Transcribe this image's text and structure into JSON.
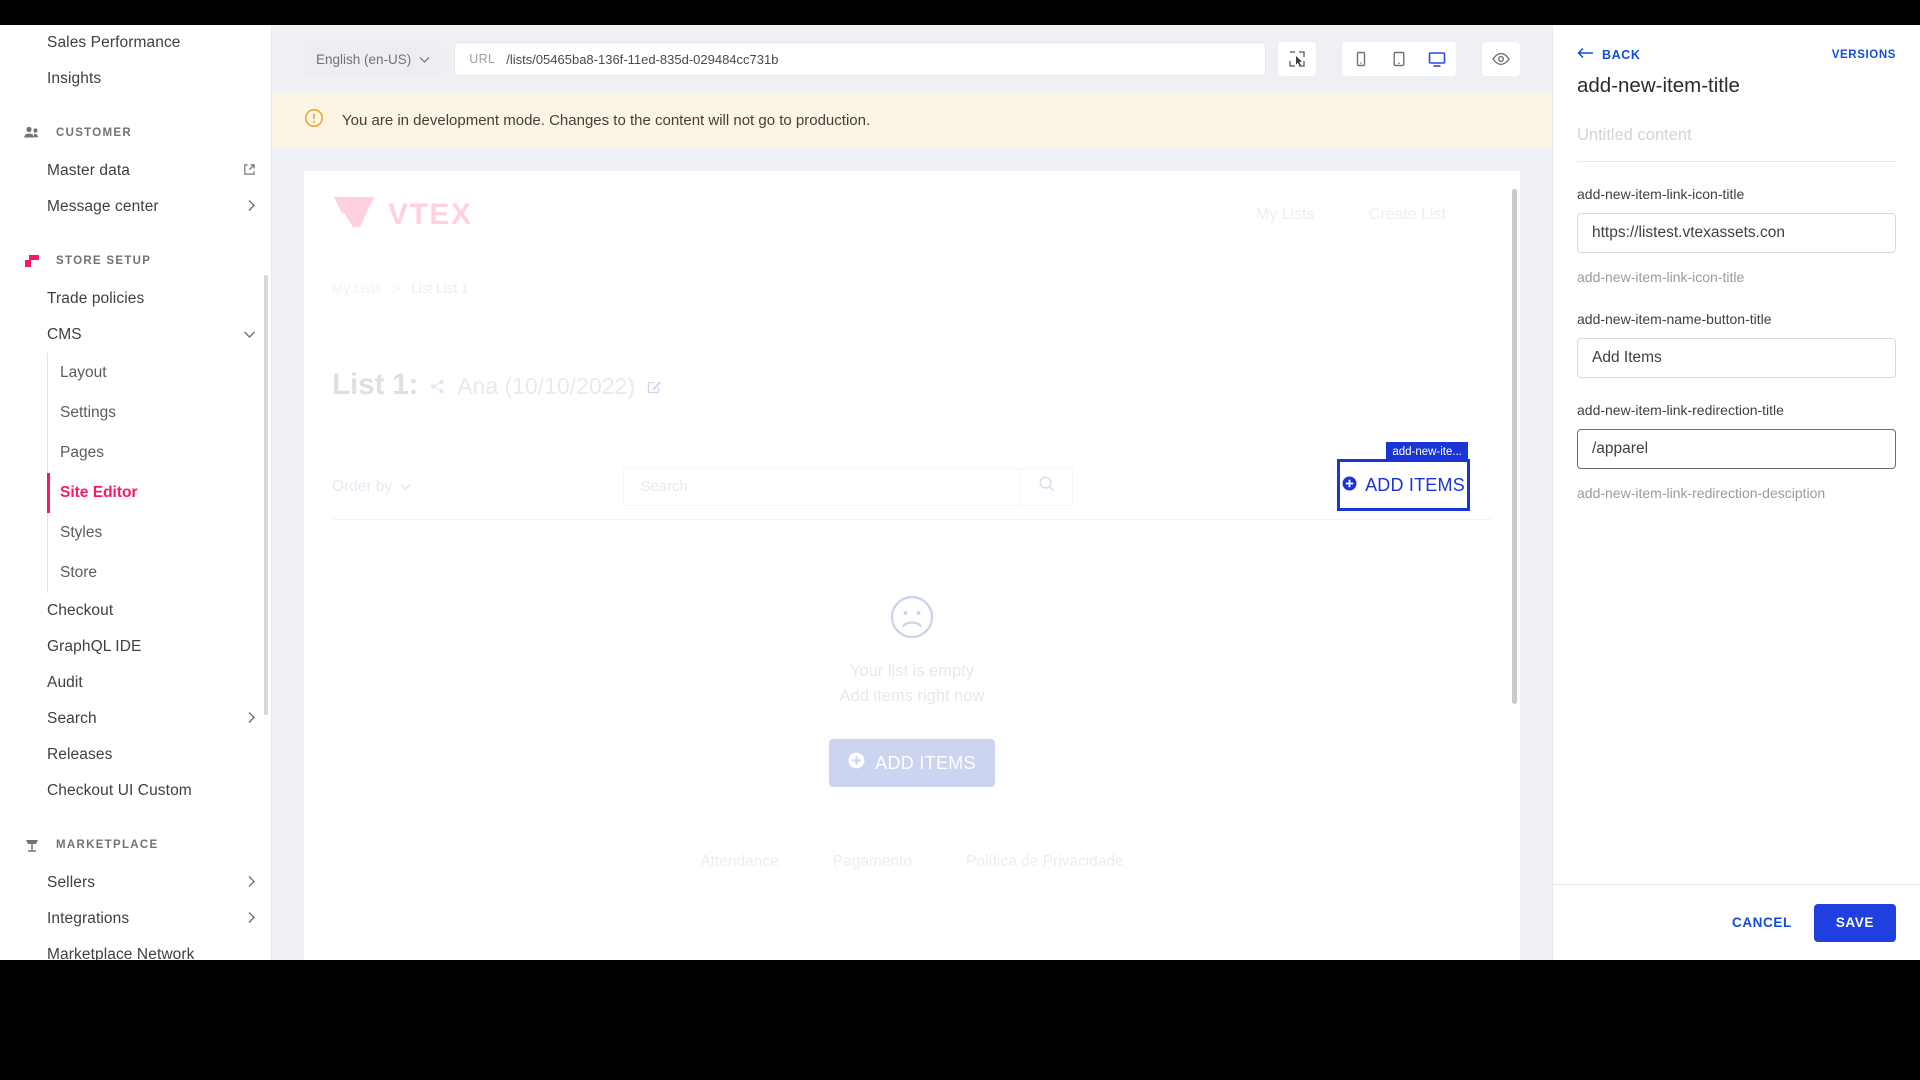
{
  "sidebar": {
    "top_items": [
      {
        "label": "Sales Performance",
        "icon": "",
        "trailing": ""
      },
      {
        "label": "Insights",
        "icon": "",
        "trailing": ""
      }
    ],
    "sections": [
      {
        "title": "CUSTOMER",
        "icon": "users-icon",
        "items": [
          {
            "label": "Master data",
            "trailing": "external-link-icon"
          },
          {
            "label": "Message center",
            "trailing": "chevron-right-icon"
          }
        ]
      },
      {
        "title": "STORE SETUP",
        "icon": "store-icon",
        "items": [
          {
            "label": "Trade policies",
            "trailing": ""
          },
          {
            "label": "CMS",
            "trailing": "chevron-down-icon"
          }
        ],
        "sub_items": [
          {
            "label": "Layout",
            "active": false
          },
          {
            "label": "Settings",
            "active": false
          },
          {
            "label": "Pages",
            "active": false
          },
          {
            "label": "Site Editor",
            "active": true
          },
          {
            "label": "Styles",
            "active": false
          },
          {
            "label": "Store",
            "active": false
          }
        ],
        "after_items": [
          {
            "label": "Checkout",
            "trailing": ""
          },
          {
            "label": "GraphQL IDE",
            "trailing": ""
          },
          {
            "label": "Audit",
            "trailing": ""
          },
          {
            "label": "Search",
            "trailing": "chevron-right-icon"
          },
          {
            "label": "Releases",
            "trailing": ""
          },
          {
            "label": "Checkout UI Custom",
            "trailing": ""
          }
        ]
      },
      {
        "title": "MARKETPLACE",
        "icon": "marketplace-icon",
        "items": [
          {
            "label": "Sellers",
            "trailing": "chevron-right-icon"
          },
          {
            "label": "Integrations",
            "trailing": "chevron-right-icon"
          },
          {
            "label": "Marketplace Network",
            "trailing": ""
          }
        ]
      }
    ]
  },
  "toolbar": {
    "language": "English (en-US)",
    "url_label": "URL",
    "url_value": "/lists/05465ba8-136f-11ed-835d-029484cc731b",
    "select_tool": "pointer-select-icon",
    "devices": [
      "mobile-icon",
      "tablet-icon",
      "desktop-icon"
    ],
    "preview": "eye-icon"
  },
  "banner": {
    "text": "You are in development mode. Changes to the content will not go to production."
  },
  "preview": {
    "brand": "VTEX",
    "nav": [
      "My Lists",
      "Create List"
    ],
    "breadcrumb": {
      "root": "My Lists",
      "separator": ">",
      "current": "List List 1"
    },
    "list_title": "List 1:",
    "list_owner": "Ana (10/10/2022)",
    "order_by": "Order by",
    "search_placeholder": "Search",
    "search_value": "",
    "highlight": {
      "tag": "add-new-ite...",
      "label": "ADD ITEMS"
    },
    "empty": {
      "line1": "Your list is empty",
      "line2": "Add items right now",
      "button": "ADD ITEMS"
    },
    "footer_links": [
      "Attendance",
      "Pagamento",
      "Política de Privacidade"
    ]
  },
  "right_panel": {
    "back": "BACK",
    "versions": "VERSIONS",
    "title": "add-new-item-title",
    "untitled": "Untitled content",
    "fields": [
      {
        "label": "add-new-item-link-icon-title",
        "value": "https://listest.vtexassets.con",
        "help": "add-new-item-link-icon-title",
        "focused": false
      },
      {
        "label": "add-new-item-name-button-title",
        "value": "Add Items",
        "help": "",
        "focused": false
      },
      {
        "label": "add-new-item-link-redirection-title",
        "value": "/apparel",
        "help": "add-new-item-link-redirection-desciption",
        "focused": true
      }
    ],
    "cancel": "CANCEL",
    "save": "SAVE"
  },
  "colors": {
    "accent_pink": "#f71963",
    "accent_blue": "#134cd8",
    "highlight_blue": "#1a34d6",
    "banner_bg": "#fdf5e3",
    "banner_icon": "#e5a32a"
  }
}
